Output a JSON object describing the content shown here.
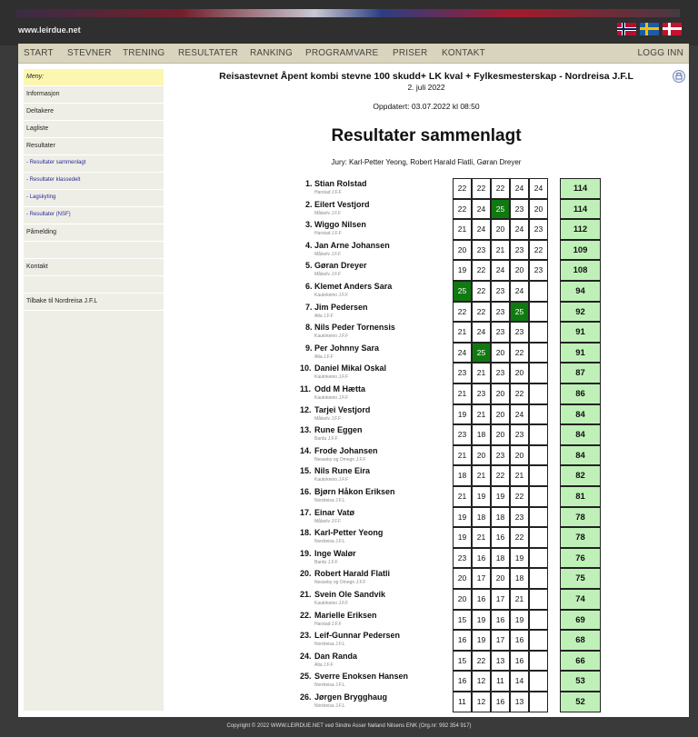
{
  "site": {
    "url": "www.leirdue.net",
    "flags": [
      "norway-flag",
      "sweden-flag",
      "denmark-flag"
    ]
  },
  "nav": {
    "items": [
      "START",
      "STEVNER",
      "TRENING",
      "RESULTATER",
      "RANKING",
      "PROGRAMVARE",
      "PRISER",
      "KONTAKT"
    ],
    "login": "LOGG INN"
  },
  "sidebar": {
    "items": [
      {
        "label": "Meny:",
        "kind": "highlight"
      },
      {
        "label": "Informasjon",
        "kind": "normal"
      },
      {
        "label": "Deltakere",
        "kind": "normal"
      },
      {
        "label": "Lagliste",
        "kind": "normal"
      },
      {
        "label": "Resultater",
        "kind": "normal"
      },
      {
        "label": "- Resultater sammenlagt",
        "kind": "sub"
      },
      {
        "label": "- Resultater klassedelt",
        "kind": "sub"
      },
      {
        "label": "- Lagskyting",
        "kind": "sub"
      },
      {
        "label": "- Resultater (NSF)",
        "kind": "sub"
      },
      {
        "label": "Påmelding",
        "kind": "normal"
      },
      {
        "label": "",
        "kind": "gap"
      },
      {
        "label": "Kontakt",
        "kind": "normal"
      },
      {
        "label": "",
        "kind": "gap"
      },
      {
        "label": "Tilbake til Nordreisa J.F.L",
        "kind": "normal"
      }
    ]
  },
  "event": {
    "title": "Reisastevnet Åpent kombi stevne 100 skudd+ LK kval + Fylkesmesterskap - Nordreisa J.F.L",
    "date": "2. juli 2022",
    "updated": "Oppdatert: 03.07.2022 kl 08:50",
    "heading": "Resultater sammenlagt",
    "jury": "Jury: Karl-Petter Yeong, Robert Harald Flatli, Gøran Dreyer"
  },
  "results": [
    {
      "rank": "1.",
      "name": "Stian Rolstad",
      "club": "Harstad J.F.F",
      "scores": [
        "22",
        "22",
        "22",
        "24",
        "24"
      ],
      "total": "114"
    },
    {
      "rank": "2.",
      "name": "Eilert Vestjord",
      "club": "Målselv J.F.F",
      "scores": [
        "22",
        "24",
        "25",
        "23",
        "20"
      ],
      "total": "114"
    },
    {
      "rank": "3.",
      "name": "Wiggo Nilsen",
      "club": "Harstad J.F.F",
      "scores": [
        "21",
        "24",
        "20",
        "24",
        "23"
      ],
      "total": "112"
    },
    {
      "rank": "4.",
      "name": "Jan Arne Johansen",
      "club": "Målselv J.F.F",
      "scores": [
        "20",
        "23",
        "21",
        "23",
        "22"
      ],
      "total": "109"
    },
    {
      "rank": "5.",
      "name": "Gøran Dreyer",
      "club": "Målselv J.F.F",
      "scores": [
        "19",
        "22",
        "24",
        "20",
        "23"
      ],
      "total": "108"
    },
    {
      "rank": "6.",
      "name": "Klemet Anders Sara",
      "club": "Kautokeino J.F.F",
      "scores": [
        "25",
        "22",
        "23",
        "24",
        ""
      ],
      "total": "94"
    },
    {
      "rank": "7.",
      "name": "Jim Pedersen",
      "club": "Alta J.F.F",
      "scores": [
        "22",
        "22",
        "23",
        "25",
        ""
      ],
      "total": "92"
    },
    {
      "rank": "8.",
      "name": "Nils Peder Tornensis",
      "club": "Kautokeino J.F.F",
      "scores": [
        "21",
        "24",
        "23",
        "23",
        ""
      ],
      "total": "91"
    },
    {
      "rank": "9.",
      "name": "Per Johnny Sara",
      "club": "Alta J.F.F",
      "scores": [
        "24",
        "25",
        "20",
        "22",
        ""
      ],
      "total": "91"
    },
    {
      "rank": "10.",
      "name": "Daniel Mikal Oskal",
      "club": "Kautokeino J.F.F",
      "scores": [
        "23",
        "21",
        "23",
        "20",
        ""
      ],
      "total": "87"
    },
    {
      "rank": "11.",
      "name": "Odd M Hætta",
      "club": "Kautokeino J.F.F",
      "scores": [
        "21",
        "23",
        "20",
        "22",
        ""
      ],
      "total": "86"
    },
    {
      "rank": "12.",
      "name": "Tarjei Vestjord",
      "club": "Målselv J.F.F",
      "scores": [
        "19",
        "21",
        "20",
        "24",
        ""
      ],
      "total": "84"
    },
    {
      "rank": "13.",
      "name": "Rune Eggen",
      "club": "Bardu J.F.F",
      "scores": [
        "23",
        "18",
        "20",
        "23",
        ""
      ],
      "total": "84"
    },
    {
      "rank": "14.",
      "name": "Frode Johansen",
      "club": "Nesseby og Omegn J.F.F",
      "scores": [
        "21",
        "20",
        "23",
        "20",
        ""
      ],
      "total": "84"
    },
    {
      "rank": "15.",
      "name": "Nils Rune Eira",
      "club": "Kautokeino J.F.F",
      "scores": [
        "18",
        "21",
        "22",
        "21",
        ""
      ],
      "total": "82"
    },
    {
      "rank": "16.",
      "name": "Bjørn Håkon Eriksen",
      "club": "Nordreisa J.F.L",
      "scores": [
        "21",
        "19",
        "19",
        "22",
        ""
      ],
      "total": "81"
    },
    {
      "rank": "17.",
      "name": "Einar Vatø",
      "club": "Målselv J.F.F",
      "scores": [
        "19",
        "18",
        "18",
        "23",
        ""
      ],
      "total": "78"
    },
    {
      "rank": "18.",
      "name": "Karl-Petter Yeong",
      "club": "Nordreisa J.F.L",
      "scores": [
        "19",
        "21",
        "16",
        "22",
        ""
      ],
      "total": "78"
    },
    {
      "rank": "19.",
      "name": "Inge Walør",
      "club": "Bardu J.F.F",
      "scores": [
        "23",
        "16",
        "18",
        "19",
        ""
      ],
      "total": "76"
    },
    {
      "rank": "20.",
      "name": "Robert Harald Flatli",
      "club": "Nesseby og Omegn J.F.F",
      "scores": [
        "20",
        "17",
        "20",
        "18",
        ""
      ],
      "total": "75"
    },
    {
      "rank": "21.",
      "name": "Svein Ole Sandvik",
      "club": "Kautokeino J.F.F",
      "scores": [
        "20",
        "16",
        "17",
        "21",
        ""
      ],
      "total": "74"
    },
    {
      "rank": "22.",
      "name": "Marielle Eriksen",
      "club": "Harstad J.F.F",
      "scores": [
        "15",
        "19",
        "16",
        "19",
        ""
      ],
      "total": "69"
    },
    {
      "rank": "23.",
      "name": "Leif-Gunnar Pedersen",
      "club": "Nordreisa J.F.L",
      "scores": [
        "16",
        "19",
        "17",
        "16",
        ""
      ],
      "total": "68"
    },
    {
      "rank": "24.",
      "name": "Dan Randa",
      "club": "Alta J.F.F",
      "scores": [
        "15",
        "22",
        "13",
        "16",
        ""
      ],
      "total": "66"
    },
    {
      "rank": "25.",
      "name": "Sverre Enoksen Hansen",
      "club": "Nordreisa J.F.L",
      "scores": [
        "16",
        "12",
        "11",
        "14",
        ""
      ],
      "total": "53"
    },
    {
      "rank": "26.",
      "name": "Jørgen Brygghaug",
      "club": "Nordreisa J.F.L",
      "scores": [
        "11",
        "12",
        "16",
        "13",
        ""
      ],
      "total": "52"
    }
  ],
  "footer": "Copyright © 2022 WWW.LEIRDUE.NET ved Sindre Asser Nøland Nilsens ENK (Org.nr: 992 354 917)",
  "colors": {
    "hit": "#107a10",
    "total_bg": "#bff0b8",
    "menu_bg": "#d9d4bd",
    "sidebar_highlight": "#fbf7b0"
  }
}
